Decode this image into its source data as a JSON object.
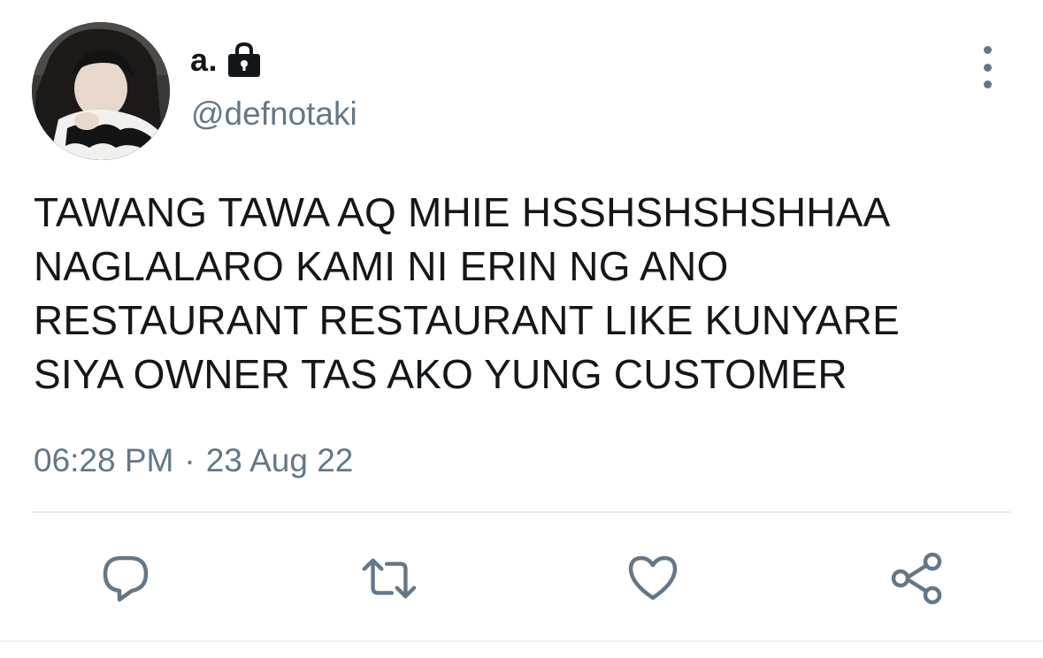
{
  "tweet": {
    "display_name": "a.",
    "handle": "@defnotaki",
    "text": "TAWANG TAWA AQ MHIE HSSHSHSHSHHAA\nNAGLALARO KAMI NI ERIN NG ANO\nRESTAURANT RESTAURANT LIKE KUNYARE\nSIYA OWNER TAS AKO YUNG CUSTOMER",
    "time": "06:28 PM",
    "separator": "·",
    "date": "23 Aug 22"
  },
  "icons": {
    "lock": "lock-icon",
    "more": "more-vertical-icon",
    "reply": "reply-icon",
    "retweet": "retweet-icon",
    "like": "heart-icon",
    "share": "share-icon"
  },
  "colors": {
    "text": "#14171a",
    "secondary": "#657786",
    "divider": "#e6ecf0"
  }
}
